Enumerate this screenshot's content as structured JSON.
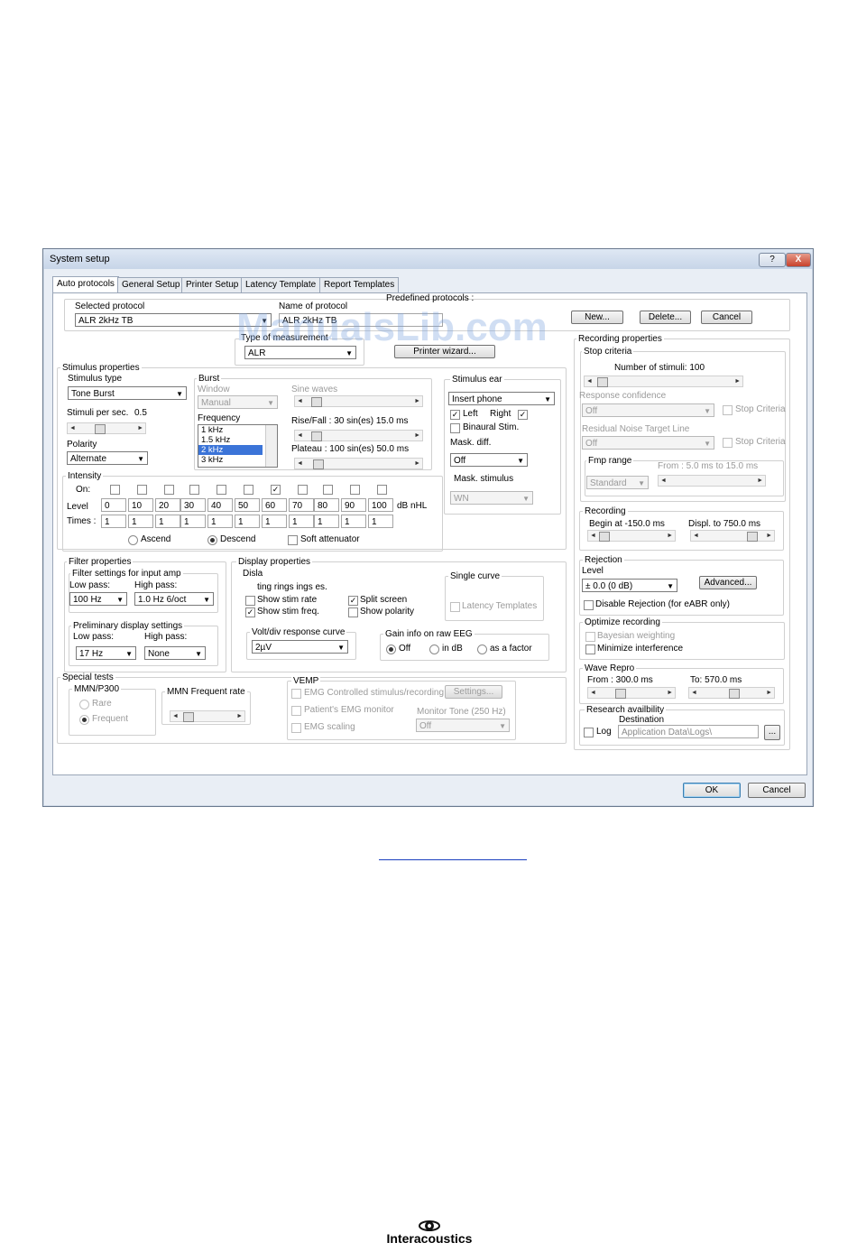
{
  "window": {
    "title": "System setup",
    "help_btn": "?",
    "close_btn": "X"
  },
  "tabs": [
    "Auto protocols",
    "General Setup",
    "Printer Setup",
    "Latency Template",
    "Report Templates"
  ],
  "protocol": {
    "selected_label": "Selected protocol",
    "selected_value": "ALR 2kHz TB",
    "name_label": "Name of protocol",
    "name_value": "ALR 2kHz TB",
    "predefined_label": "Predefined protocols :",
    "new_btn": "New...",
    "delete_btn": "Delete...",
    "cancel_btn": "Cancel"
  },
  "measurement": {
    "label": "Type of measurement",
    "value": "ALR",
    "printer_wizard": "Printer wizard..."
  },
  "stimulus": {
    "group": "Stimulus properties",
    "type_label": "Stimulus type",
    "type_value": "Tone Burst",
    "rate_label": "Stimuli per sec.",
    "rate_value": "0.5",
    "polarity_label": "Polarity",
    "polarity_value": "Alternate",
    "burst": {
      "group": "Burst",
      "window_label": "Window",
      "window_value": "Manual",
      "sine_label": "Sine waves",
      "freq_label": "Frequency",
      "freq_items": [
        "1 kHz",
        "1.5 kHz",
        "2 kHz",
        "3 kHz"
      ],
      "freq_selected": 2,
      "risefall": "Rise/Fall :  30 sin(es) 15.0 ms",
      "plateau": "Plateau :  100 sin(es) 50.0 ms"
    },
    "ear": {
      "group": "Stimulus ear",
      "value": "Insert phone",
      "left": "Left",
      "right": "Right",
      "left_checked": true,
      "right_checked": true,
      "binaural": "Binaural Stim.",
      "mask_diff_label": "Mask. diff.",
      "mask_diff_value": "Off",
      "mask_stim_label": "Mask. stimulus",
      "mask_stim_value": "WN"
    }
  },
  "intensity": {
    "group": "Intensity",
    "on_label": "On:",
    "level_label": "Level",
    "times_label": "Times :",
    "unit": "dB nHL",
    "levels": [
      "0",
      "10",
      "20",
      "30",
      "40",
      "50",
      "60",
      "70",
      "80",
      "90",
      "100"
    ],
    "times": [
      "1",
      "1",
      "1",
      "1",
      "1",
      "1",
      "1",
      "1",
      "1",
      "1",
      "1"
    ],
    "on_checked": [
      false,
      false,
      false,
      false,
      false,
      false,
      true,
      false,
      false,
      false,
      false
    ],
    "ascend": "Ascend",
    "descend": "Descend",
    "soft": "Soft attenuator"
  },
  "filter": {
    "group": "Filter properties",
    "input_group": "Filter settings for input amp",
    "low_label": "Low pass:",
    "low_value": "100 Hz",
    "high_label": "High pass:",
    "high_value": "1.0 Hz 6/oct",
    "prelim_group": "Preliminary display settings",
    "p_low_label": "Low pass:",
    "p_low_value": "17 Hz",
    "p_high_label": "High pass:",
    "p_high_value": "None"
  },
  "display": {
    "group": "Display properties",
    "frag1": "Disla",
    "frag2": "ting rings ings es.",
    "show_rate": "Show stim rate",
    "show_freq": "Show stim freq.",
    "split": "Split screen",
    "polarity": "Show polarity",
    "single_curve": "Single curve",
    "latency_templates": "Latency Templates",
    "volt_label": "Volt/div response curve",
    "volt_value": "2µV",
    "gain_label": "Gain info on raw EEG",
    "gain_off": "Off",
    "gain_db": "in dB",
    "gain_factor": "as a factor"
  },
  "special": {
    "group": "Special tests",
    "mmn": "MMN/P300",
    "rare": "Rare",
    "frequent": "Frequent",
    "mmn_rate": "MMN Frequent rate",
    "vemp": "VEMP",
    "emg_ctrl": "EMG Controlled stimulus/recording",
    "settings_btn": "Settings...",
    "emg_monitor": "Patient's EMG monitor",
    "monitor_tone": "Monitor Tone (250 Hz)",
    "monitor_value": "Off",
    "emg_scaling": "EMG scaling"
  },
  "recording_props": {
    "group": "Recording properties",
    "stop_group": "Stop criteria",
    "num_stimuli": "Number of stimuli:  100",
    "resp_conf": "Response confidence",
    "resp_value": "Off",
    "stop_criteria": "Stop Criteria",
    "residual": "Residual Noise Target Line",
    "residual_value": "Off",
    "fmp_group": "Fmp range",
    "fmp_value": "Standard",
    "fmp_range": "From : 5.0 ms to 15.0 ms",
    "rec_group": "Recording",
    "begin": "Begin at  -150.0 ms",
    "displ": "Displ. to  750.0 ms",
    "rej_group": "Rejection",
    "rej_level": "Level",
    "rej_value": "± 0.0 (0 dB)",
    "advanced_btn": "Advanced...",
    "disable_rej": "Disable Rejection (for eABR only)",
    "opt_group": "Optimize recording",
    "bayesian": "Bayesian weighting",
    "minimize": "Minimize interference",
    "wave_group": "Wave Repro",
    "wave_from": "From :  300.0 ms",
    "wave_to": "To:    570.0 ms",
    "research_group": "Research availbility",
    "log": "Log",
    "destination": "Destination",
    "dest_value": "Application Data\\Logs\\",
    "browse_btn": "..."
  },
  "footer": {
    "ok": "OK",
    "cancel": "Cancel"
  },
  "watermark": "ManualsLib.com",
  "brand": "Interacoustics"
}
